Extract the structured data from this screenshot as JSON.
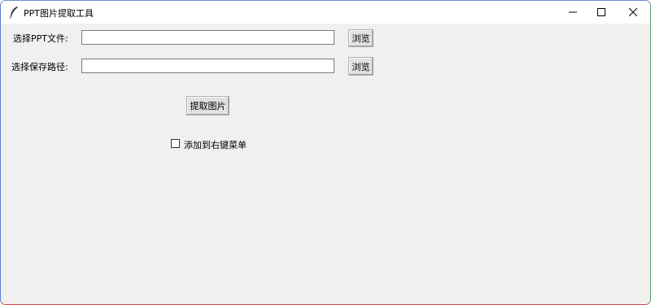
{
  "window": {
    "title": "PPT图片提取工具",
    "icon": "feather-icon"
  },
  "file_row": {
    "label": "选择PPT文件:",
    "value": "",
    "browse_label": "浏览"
  },
  "save_row": {
    "label": "选择保存路径:",
    "value": "",
    "browse_label": "浏览"
  },
  "extract_button": "提取图片",
  "context_menu_option": {
    "label": "添加到右键菜单",
    "checked": false
  },
  "colors": {
    "background": "#f0f0f0",
    "titlebar": "#ffffff",
    "button_face": "#e1e1e1"
  }
}
